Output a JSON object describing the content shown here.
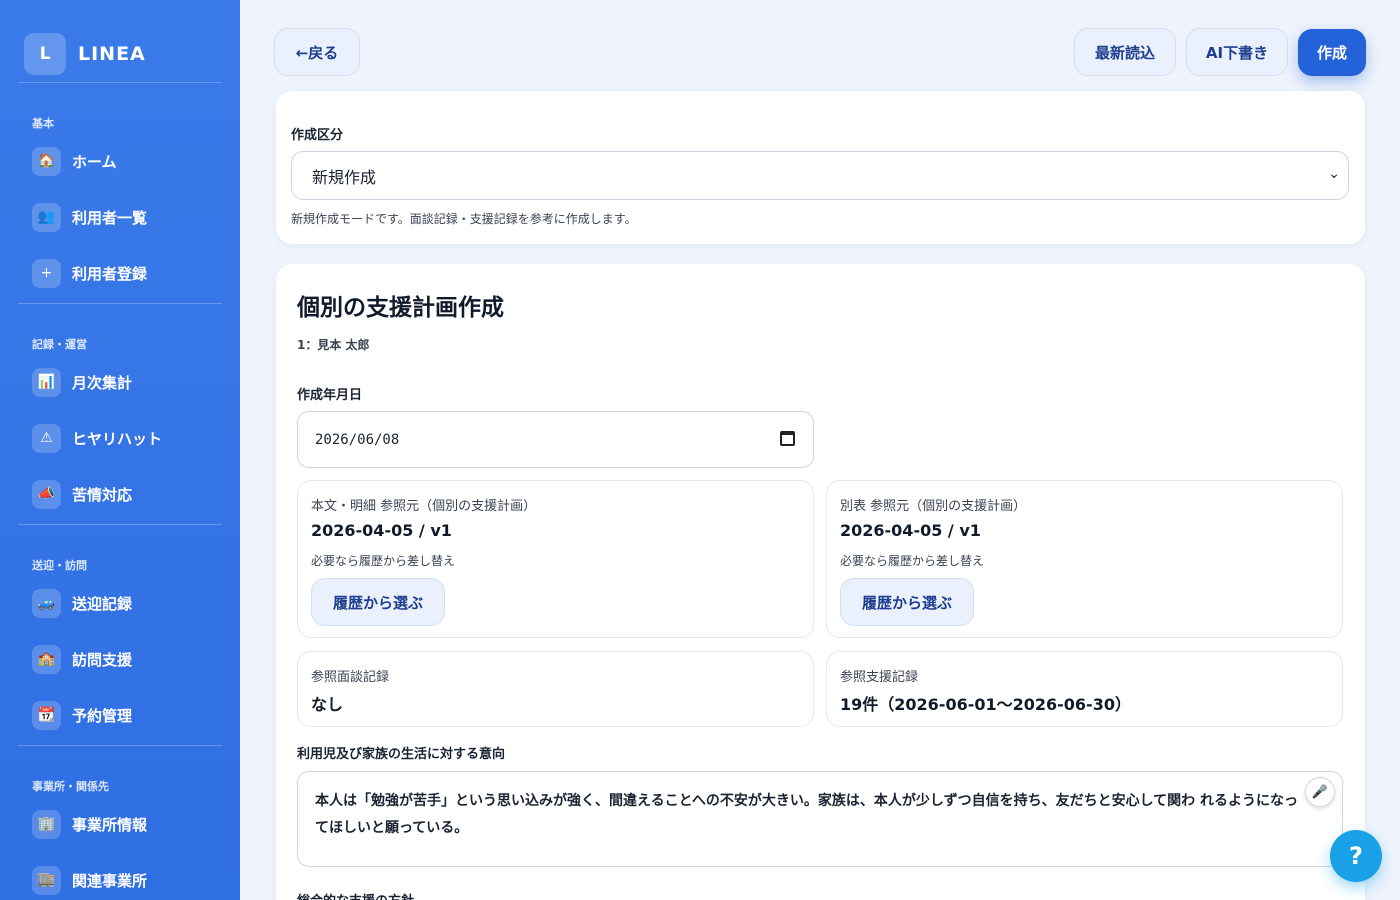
{
  "brand": {
    "logo_letter": "L",
    "name": "LINEA"
  },
  "sidebar": {
    "sections": [
      {
        "label": "基本",
        "items": [
          {
            "icon": "🏠",
            "icon_name": "home-icon",
            "label": "ホーム"
          },
          {
            "icon": "👥",
            "icon_name": "users-icon",
            "label": "利用者一覧"
          },
          {
            "icon": "+",
            "icon_name": "plus-icon",
            "label": "利用者登録"
          }
        ]
      },
      {
        "label": "記録・運営",
        "items": [
          {
            "icon": "📊",
            "icon_name": "bar-chart-icon",
            "label": "月次集計"
          },
          {
            "icon": "⚠",
            "icon_name": "warning-icon",
            "label": "ヒヤリハット"
          },
          {
            "icon": "📣",
            "icon_name": "megaphone-icon",
            "label": "苦情対応"
          }
        ]
      },
      {
        "label": "送迎・訪問",
        "items": [
          {
            "icon": "🚙",
            "icon_name": "car-icon",
            "label": "送迎記録"
          },
          {
            "icon": "🏫",
            "icon_name": "building-icon",
            "label": "訪問支援"
          },
          {
            "icon": "📆",
            "icon_name": "calendar-icon",
            "label": "予約管理"
          }
        ]
      },
      {
        "label": "事業所・関係先",
        "items": [
          {
            "icon": "🏢",
            "icon_name": "office-icon",
            "label": "事業所情報"
          },
          {
            "icon": "🏬",
            "icon_name": "office-building-icon",
            "label": "関連事業所"
          }
        ]
      }
    ]
  },
  "toolbar": {
    "back_label": "←戻る",
    "reload_label": "最新読込",
    "ai_draft_label": "AI下書き",
    "create_label": "作成"
  },
  "mode_card": {
    "label": "作成区分",
    "selected": "新規作成",
    "hint": "新規作成モードです。面談記録・支援記録を参考に作成します。"
  },
  "plan": {
    "title": "個別の支援計画作成",
    "subject": "1：見本 太郎",
    "date_label": "作成年月日",
    "date_value": "2026/06/08",
    "ref_main": {
      "title": "本文・明細 参照元（個別の支援計画）",
      "value": "2026-04-05 / v1",
      "note": "必要なら履歴から差し替え",
      "button": "履歴から選ぶ"
    },
    "ref_appendix": {
      "title": "別表 参照元（個別の支援計画）",
      "value": "2026-04-05 / v1",
      "note": "必要なら履歴から差し替え",
      "button": "履歴から選ぶ"
    },
    "ref_interview": {
      "title": "参照面談記録",
      "value": "なし"
    },
    "ref_support": {
      "title": "参照支援記録",
      "value": "19件（2026-06-01〜2026-06-30）"
    },
    "intent_label": "利用児及び家族の生活に対する意向",
    "intent_text": "本人は「勉強が苦手」という思い込みが強く、間違えることへの不安が大きい。家族は、本人が少しずつ自信を持ち、友だちと安心して関わ れるようになってほしいと願っている。",
    "policy_label": "総合的な支援の方針"
  },
  "help": {
    "label": "?"
  },
  "colors": {
    "sidebar": "#3a7ae8",
    "primary": "#2362d9",
    "help": "#1aa0e6",
    "background": "#eef3fc"
  }
}
